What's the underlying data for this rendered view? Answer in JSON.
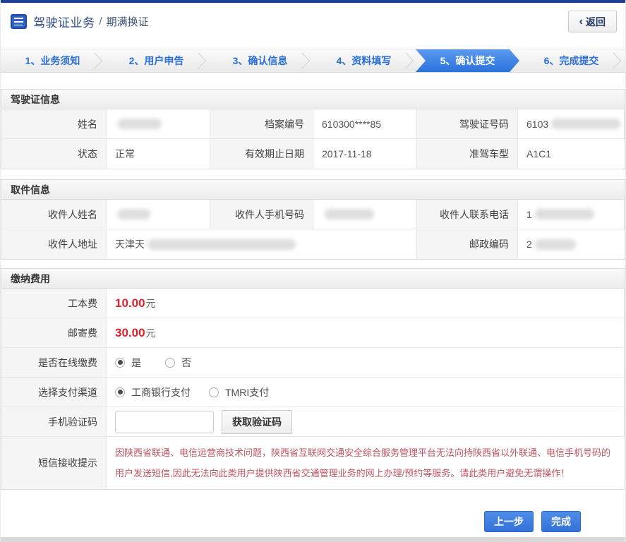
{
  "header": {
    "title_primary": "驾驶证业务",
    "title_divider": "/",
    "title_secondary": "期满换证",
    "back_label": "返回",
    "back_chevron": "‹"
  },
  "steps": [
    "1、业务须知",
    "2、用户申告",
    "3、确认信息",
    "4、资料填写",
    "5、确认提交",
    "6、完成提交"
  ],
  "active_step_index": 4,
  "license": {
    "title": "驾驶证信息",
    "name_label": "姓名",
    "name_value": "",
    "file_label": "档案编号",
    "file_value": "610300****85",
    "number_label": "驾驶证号码",
    "number_value": "6103",
    "status_label": "状态",
    "status_value": "正常",
    "expiry_label": "有效期止日期",
    "expiry_value": "2017-11-18",
    "class_label": "准驾车型",
    "class_value": "A1C1"
  },
  "pickup": {
    "title": "取件信息",
    "name_label": "收件人姓名",
    "name_value": "",
    "mobile_label": "收件人手机号码",
    "mobile_value": "",
    "phone_label": "收件人联系电话",
    "phone_value": "1",
    "address_label": "收件人地址",
    "address_value": "天津天",
    "postcode_label": "邮政编码",
    "postcode_value": "2"
  },
  "payment": {
    "title": "缴纳费用",
    "fee1_label": "工本费",
    "fee1_amount": "10.00",
    "fee1_unit": "元",
    "fee2_label": "邮寄费",
    "fee2_amount": "30.00",
    "fee2_unit": "元",
    "online_label": "是否在线缴费",
    "online_yes": "是",
    "online_no": "否",
    "online_selected": "是",
    "channel_label": "选择支付渠道",
    "channel_option1": "工商银行支付",
    "channel_option2": "TMRI支付",
    "channel_selected": "工商银行支付",
    "captcha_label": "手机验证码",
    "captcha_value": "",
    "captcha_button": "获取验证码",
    "notice_label": "短信接收提示",
    "notice_text": "因陕西省联通、电信运营商技术问题，陕西省互联网交通安全综合服务管理平台无法向持陕西省以外联通、电信手机号码的用户发送短信,因此无法向此类用户提供陕西省交通管理业务的网上办理/预约等服务。请此类用户避免无谓操作！"
  },
  "footer": {
    "prev": "上一步",
    "finish": "完成"
  },
  "colors": {
    "topbar_navy": "#1d3e94",
    "accent_blue": "#2e74dd",
    "step_text_blue": "#2a6fd6",
    "fee_red": "#e5222a",
    "notice_red": "#c05460"
  }
}
